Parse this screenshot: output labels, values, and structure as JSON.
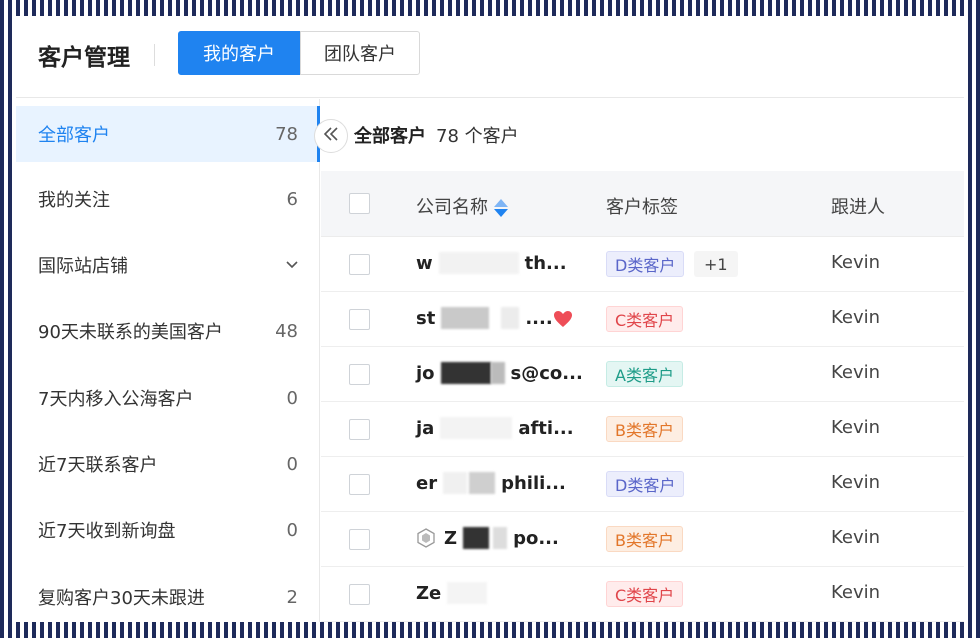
{
  "header": {
    "title": "客户管理",
    "tabs": [
      {
        "label": "我的客户",
        "active": true
      },
      {
        "label": "团队客户",
        "active": false
      }
    ]
  },
  "sidebar": {
    "items": [
      {
        "label": "全部客户",
        "count": "78",
        "active": true
      },
      {
        "label": "我的关注",
        "count": "6"
      },
      {
        "label": "国际站店铺",
        "count": "",
        "icon": "chevron-down-icon"
      },
      {
        "label": "90天未联系的美国客户",
        "count": "48"
      },
      {
        "label": "7天内移入公海客户",
        "count": "0"
      },
      {
        "label": "近7天联系客户",
        "count": "0"
      },
      {
        "label": "近7天收到新询盘",
        "count": "0"
      },
      {
        "label": "复购客户30天未跟进",
        "count": "2"
      }
    ]
  },
  "main": {
    "collapse_icon": "double-chevron-left-icon",
    "heading": "全部客户",
    "count_text": "78 个客户"
  },
  "table": {
    "columns": [
      "公司名称",
      "客户标签",
      "跟进人"
    ],
    "rows": [
      {
        "company_start": "w",
        "company_end": "th...",
        "tag": "D类客户",
        "tag_type": "D",
        "extra_tag": "+1",
        "owner": "Kevin"
      },
      {
        "company_start": "st",
        "company_end": "....",
        "tag": "C类客户",
        "tag_type": "C",
        "favorite": true,
        "owner": "Kevin"
      },
      {
        "company_start": "jo",
        "company_end": "s@co...",
        "tag": "A类客户",
        "tag_type": "A",
        "owner": "Kevin"
      },
      {
        "company_start": "ja",
        "company_end": "afti...",
        "tag": "B类客户",
        "tag_type": "B",
        "owner": "Kevin"
      },
      {
        "company_start": "er",
        "company_end": "phili...",
        "tag": "D类客户",
        "tag_type": "D",
        "owner": "Kevin"
      },
      {
        "company_start": "Z",
        "company_end": "po...",
        "tag": "B类客户",
        "tag_type": "B",
        "icon": "hexagon-logo-icon",
        "owner": "Kevin"
      },
      {
        "company_start": "Ze",
        "company_end": "",
        "tag": "C类客户",
        "tag_type": "C",
        "owner": "Kevin"
      }
    ]
  },
  "colors": {
    "primary": "#1f83f0",
    "active_bg": "#e8f3ff",
    "favorite": "#ee4d57"
  }
}
